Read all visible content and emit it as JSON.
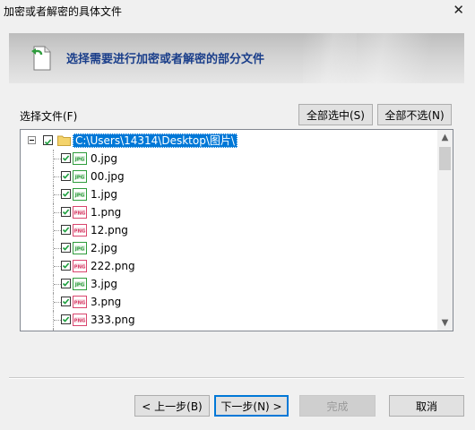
{
  "window": {
    "title": "加密或者解密的具体文件",
    "close_glyph": "✕"
  },
  "banner": {
    "text": "选择需要进行加密或者解密的部分文件",
    "icon": "file-arrow-icon"
  },
  "file_section": {
    "label": "选择文件(F)",
    "select_all": "全部选中(S)",
    "select_none": "全部不选(N)"
  },
  "tree": {
    "root_path": "C:\\Users\\14314\\Desktop\\图片\\",
    "root_checked": true,
    "files": [
      {
        "name": "0.jpg",
        "type": "jpg",
        "checked": true
      },
      {
        "name": "00.jpg",
        "type": "jpg",
        "checked": true
      },
      {
        "name": "1.jpg",
        "type": "jpg",
        "checked": true
      },
      {
        "name": "1.png",
        "type": "png",
        "checked": true
      },
      {
        "name": "12.png",
        "type": "png",
        "checked": true
      },
      {
        "name": "2.jpg",
        "type": "jpg",
        "checked": true
      },
      {
        "name": "222.png",
        "type": "png",
        "checked": true
      },
      {
        "name": "3.jpg",
        "type": "jpg",
        "checked": true
      },
      {
        "name": "3.png",
        "type": "png",
        "checked": true
      },
      {
        "name": "333.png",
        "type": "png",
        "checked": true
      }
    ]
  },
  "buttons": {
    "prev": "< 上一步(B)",
    "next": "下一步(N) >",
    "finish": "完成",
    "cancel": "取消"
  },
  "colors": {
    "accent": "#0078d7",
    "banner_text": "#1a3e8a",
    "jpg_icon": "#2e9c3c",
    "png_icon": "#d9466e"
  }
}
